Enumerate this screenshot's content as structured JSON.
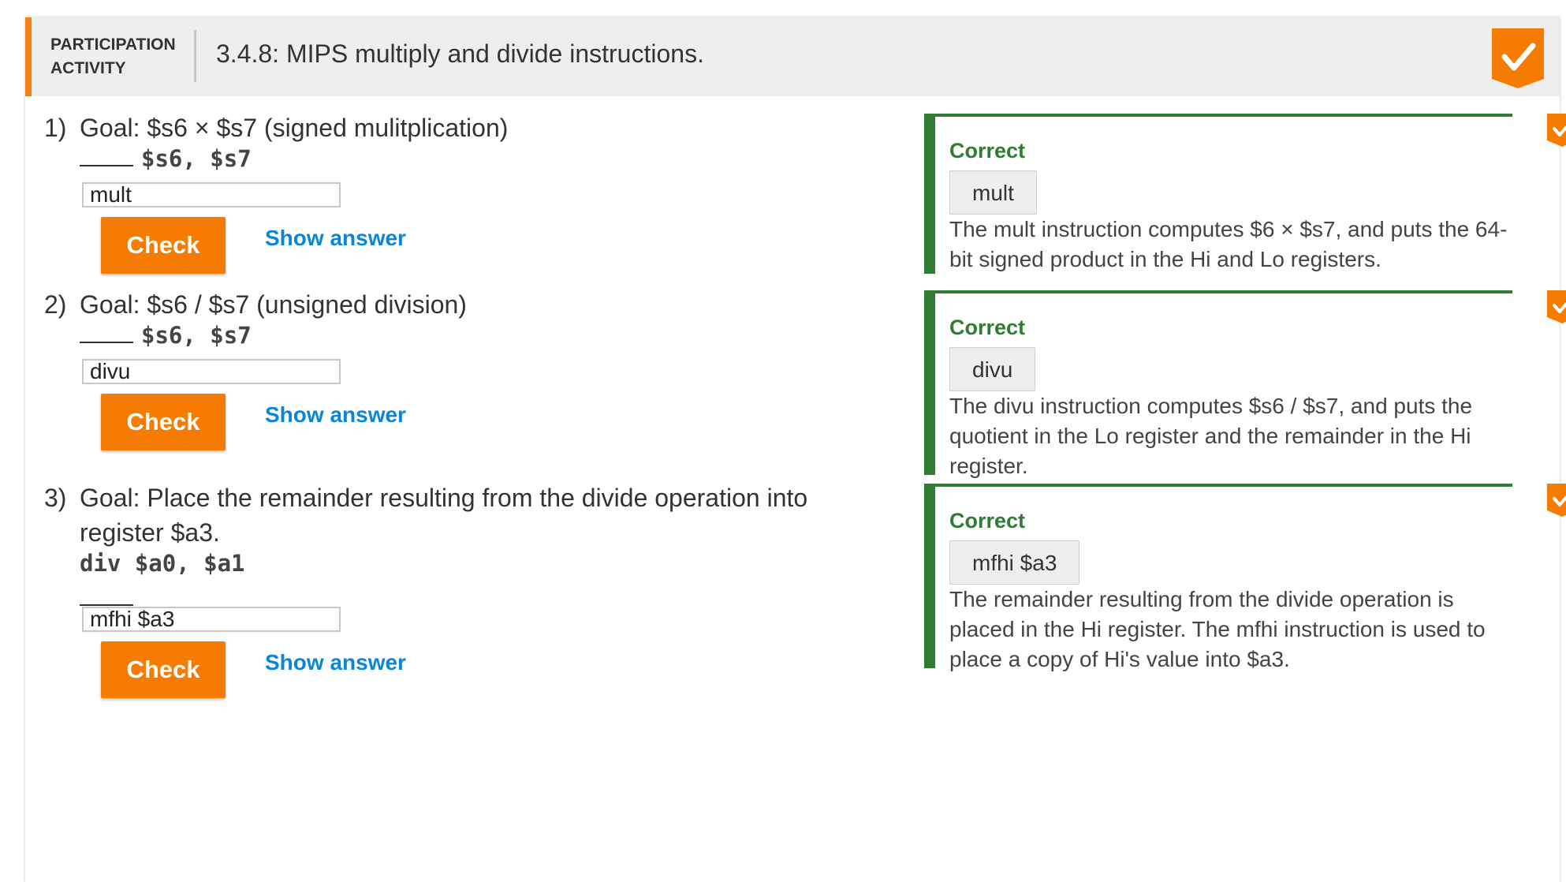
{
  "header": {
    "type_line1": "PARTICIPATION",
    "type_line2": "ACTIVITY",
    "title": "3.4.8: MIPS multiply and divide instructions.",
    "badge_icon": "checkmark-icon",
    "accent_color": "#f57f17"
  },
  "questions": [
    {
      "number": "1)",
      "goal": "Goal: $s6 × $s7   (signed mulitplication)",
      "code_prefix": "",
      "code_suffix": "$s6, $s7",
      "input_value": "mult",
      "check_label": "Check",
      "show_answer_label": "Show answer",
      "feedback": {
        "status": "Correct",
        "answer": "mult",
        "explanation": "The mult instruction computes $6 × $s7, and puts the 64-bit signed product in the Hi and Lo registers."
      }
    },
    {
      "number": "2)",
      "goal": "Goal: $s6 / $s7   (unsigned division)",
      "code_prefix": "",
      "code_suffix": "$s6, $s7",
      "input_value": "divu",
      "check_label": "Check",
      "show_answer_label": "Show answer",
      "feedback": {
        "status": "Correct",
        "answer": "divu",
        "explanation": "The divu instruction computes $s6 / $s7, and puts the quotient in the Lo register and the remainder in the Hi register."
      }
    },
    {
      "number": "3)",
      "goal": "Goal: Place the remainder resulting from the divide operation into register $a3.",
      "code_line": "div $a0, $a1",
      "input_value": "mfhi $a3",
      "check_label": "Check",
      "show_answer_label": "Show answer",
      "feedback": {
        "status": "Correct",
        "answer": "mfhi $a3",
        "explanation": "The remainder resulting from the divide operation is placed in the Hi register. The mfhi instruction is used to place a copy of Hi's value into $a3."
      }
    }
  ],
  "colors": {
    "orange": "#f57c00",
    "correct_green": "#2e7d32",
    "link_blue": "#0a86d8"
  }
}
